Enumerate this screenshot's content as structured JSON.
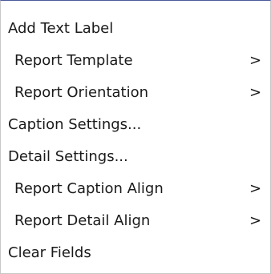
{
  "menu": {
    "items": [
      {
        "label": "Add Text Label",
        "submenu": false,
        "arrow": ""
      },
      {
        "label": "Report Template",
        "submenu": true,
        "arrow": ">"
      },
      {
        "label": "Report Orientation",
        "submenu": true,
        "arrow": ">"
      },
      {
        "label": "Caption Settings...",
        "submenu": false,
        "arrow": ""
      },
      {
        "label": "Detail Settings...",
        "submenu": false,
        "arrow": ""
      },
      {
        "label": "Report Caption Align",
        "submenu": true,
        "arrow": ">"
      },
      {
        "label": "Report Detail Align",
        "submenu": true,
        "arrow": ">"
      },
      {
        "label": "Clear Fields",
        "submenu": false,
        "arrow": ""
      }
    ]
  }
}
